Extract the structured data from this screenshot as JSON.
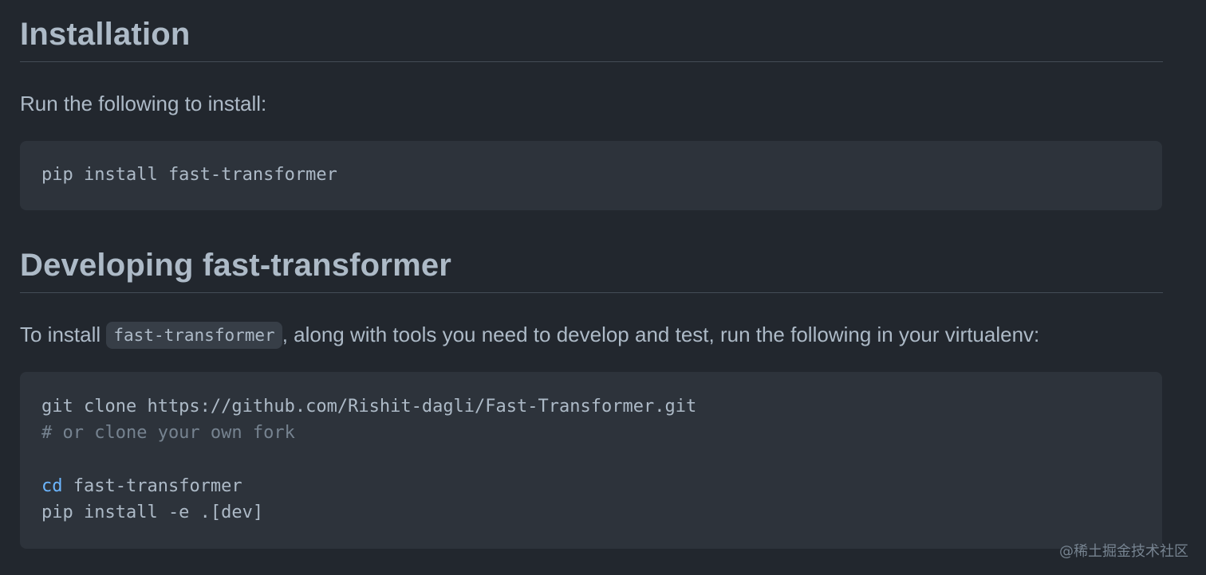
{
  "sections": {
    "installation": {
      "heading": "Installation",
      "intro": "Run the following to install:",
      "code": "pip install fast-transformer"
    },
    "developing": {
      "heading": "Developing fast-transformer",
      "intro_before": "To install ",
      "intro_code": "fast-transformer",
      "intro_after": ", along with tools you need to develop and test, run the following in your virtualenv:",
      "code": {
        "line1": "git clone https://github.com/Rishit-dagli/Fast-Transformer.git",
        "line2": "# or clone your own fork",
        "line3_keyword": "cd",
        "line3_rest": " fast-transformer",
        "line4": "pip install -e .[dev]"
      }
    }
  },
  "watermark": "@稀土掘金技术社区",
  "colors": {
    "background": "#22272e",
    "code_background": "#2d333b",
    "text": "#adbac7",
    "comment": "#768390",
    "keyword": "#6cb6ff"
  }
}
